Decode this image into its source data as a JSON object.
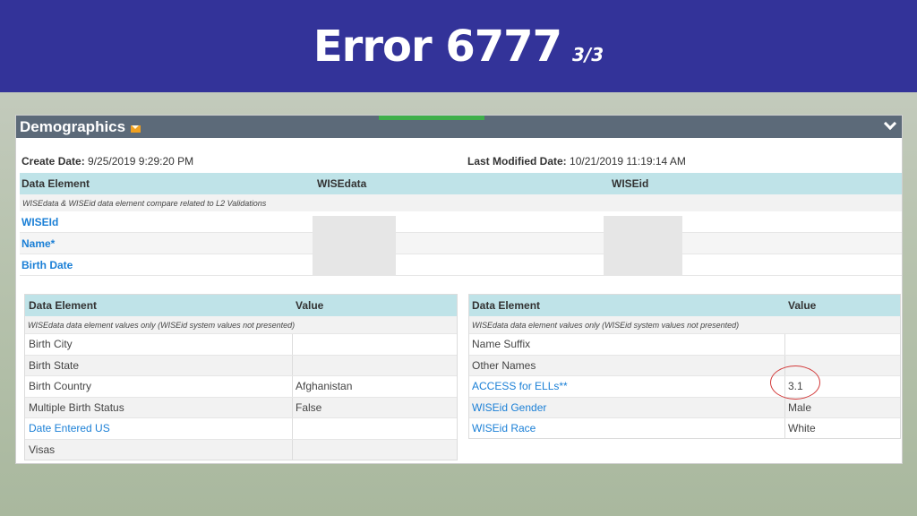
{
  "slide": {
    "title": "Error 6777",
    "subtitle": "3/3"
  },
  "panel": {
    "title": "Demographics"
  },
  "meta": {
    "create_label": "Create Date:",
    "create_value": "9/25/2019 9:29:20 PM",
    "modified_label": "Last Modified Date:",
    "modified_value": "10/21/2019 11:19:14 AM"
  },
  "compare_table": {
    "headers": [
      "Data Element",
      "WISEdata",
      "WISEid"
    ],
    "note": "WISEdata & WISEid data element compare related to L2 Validations",
    "rows": [
      "WISEId",
      "Name*",
      "Birth Date"
    ]
  },
  "left_table": {
    "headers": [
      "Data Element",
      "Value"
    ],
    "note": "WISEdata data element values only (WISEid system values not presented)",
    "rows": [
      {
        "element": "Birth City",
        "value": ""
      },
      {
        "element": "Birth State",
        "value": ""
      },
      {
        "element": "Birth Country",
        "value": "Afghanistan"
      },
      {
        "element": "Multiple Birth Status",
        "value": "False"
      },
      {
        "element": "Date Entered US",
        "value": ""
      },
      {
        "element": "Visas",
        "value": ""
      }
    ]
  },
  "right_table": {
    "headers": [
      "Data Element",
      "Value"
    ],
    "note": "WISEdata data element values only (WISEid system values not presented)",
    "rows": [
      {
        "element": "Name Suffix",
        "value": ""
      },
      {
        "element": "Other Names",
        "value": ""
      },
      {
        "element": "ACCESS for ELLs**",
        "value": "3.1"
      },
      {
        "element": "WISEid Gender",
        "value": "Male"
      },
      {
        "element": "WISEid Race",
        "value": "White"
      }
    ]
  },
  "colors": {
    "title_bar": "#333399",
    "panel_header": "#5c6a79",
    "table_header": "#bfe3e8",
    "link": "#1a7fd6",
    "highlight_circle": "#d23a3a"
  }
}
